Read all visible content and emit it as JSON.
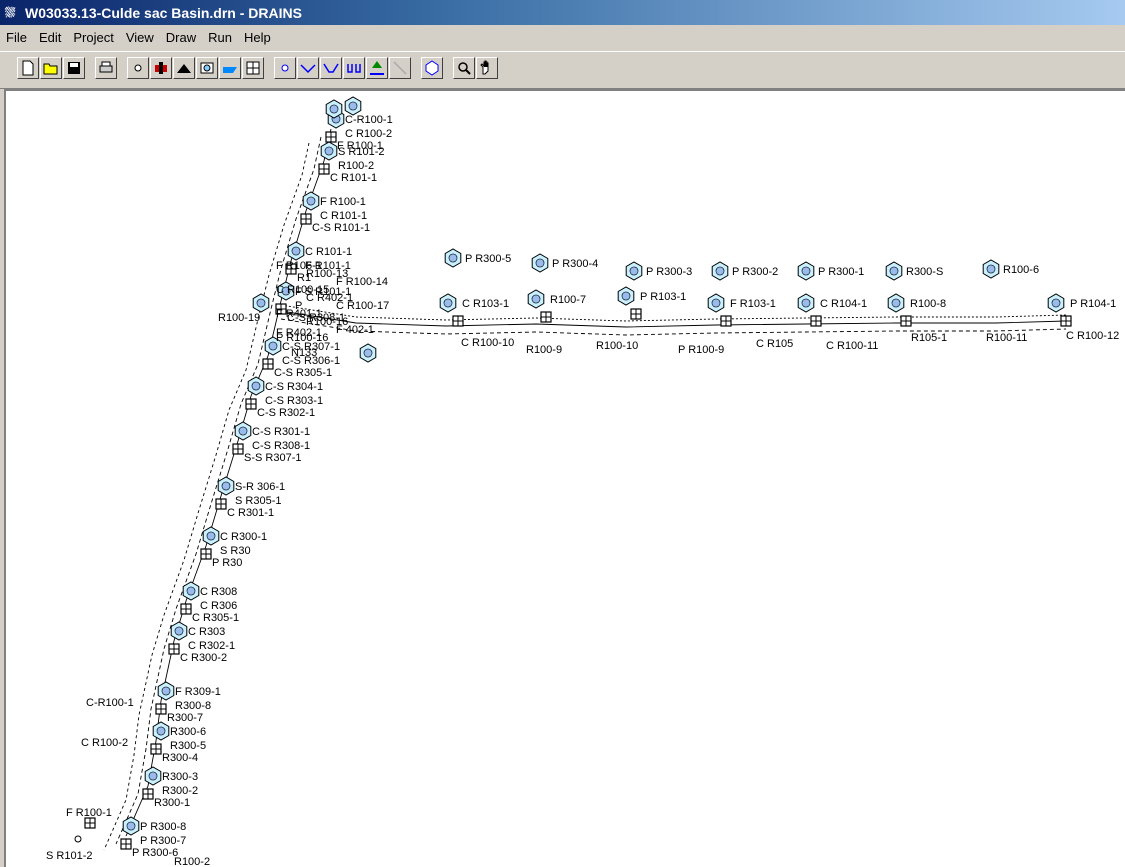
{
  "window": {
    "title": "W03033.13-Culde sac Basin.drn - DRAINS"
  },
  "menu": [
    "File",
    "Edit",
    "Project",
    "View",
    "Draw",
    "Run",
    "Help"
  ],
  "toolbar": [
    "new-file",
    "open-file",
    "save",
    "print",
    "node",
    "pit",
    "detention-basin",
    "headwall",
    "outlet",
    "culvert",
    "node-small",
    "pipe",
    "channel",
    "overflow-route",
    "catchment",
    "link",
    "polygon",
    "zoom",
    "pan"
  ],
  "colors": {
    "titlebar": "#0a246a",
    "canvas": "#ffffff",
    "catchment": "#c8f0ff"
  },
  "labels": [
    "C-R100-1",
    "C R100-2",
    "F R100-1",
    "S R101-2",
    "R100-2",
    "C R101-1",
    "F R100-1",
    "C R101-1",
    "C-S R101-1",
    "C R101-1",
    "F R101-1",
    "R1",
    "F S R101-1",
    "P",
    "C-S R308-1",
    "C-S R307-1",
    "C-S R306-1",
    "C-S R305-1",
    "C-S R304-1",
    "C-S R303-1",
    "C-S R302-1",
    "C-S R301-1",
    "C-S R308-1",
    "S-S R307-1",
    "S-R 306-1",
    "S R305-1",
    "C R301-1",
    "C R300-1",
    "S R30",
    "P R30",
    "C R308",
    "C R306",
    "C R305-1",
    "C R303",
    "C R302-1",
    "C R300-2",
    "F R309-1",
    "R300-8",
    "R300-7",
    "R300-6",
    "R300-5",
    "R300-4",
    "R300-3",
    "R300-2",
    "R300-1",
    "P R300-8",
    "P R300-7",
    "P R300-6",
    "P R300-5",
    "P R300-4",
    "P R300-3",
    "P R300-2",
    "P R300-1",
    "R300-S",
    "R100-6",
    "C R103-1",
    "R100-7",
    "P R103-1",
    "F R103-1",
    "C R104-1",
    "R100-8",
    "P R104-1",
    "C R100-10",
    "R100-9",
    "R100-10",
    "P R100-9",
    "C R105",
    "C R100-11",
    "R105-1",
    "R100-11",
    "C R100-12",
    "F R106-1",
    "R100-13",
    "F R100-14",
    "C R100-15",
    "C R402-1",
    "C R100-17",
    "F R401-1",
    "R100-16",
    "F 402-1",
    "P R100-16",
    "R100-19",
    "F R402-1",
    "N133"
  ]
}
